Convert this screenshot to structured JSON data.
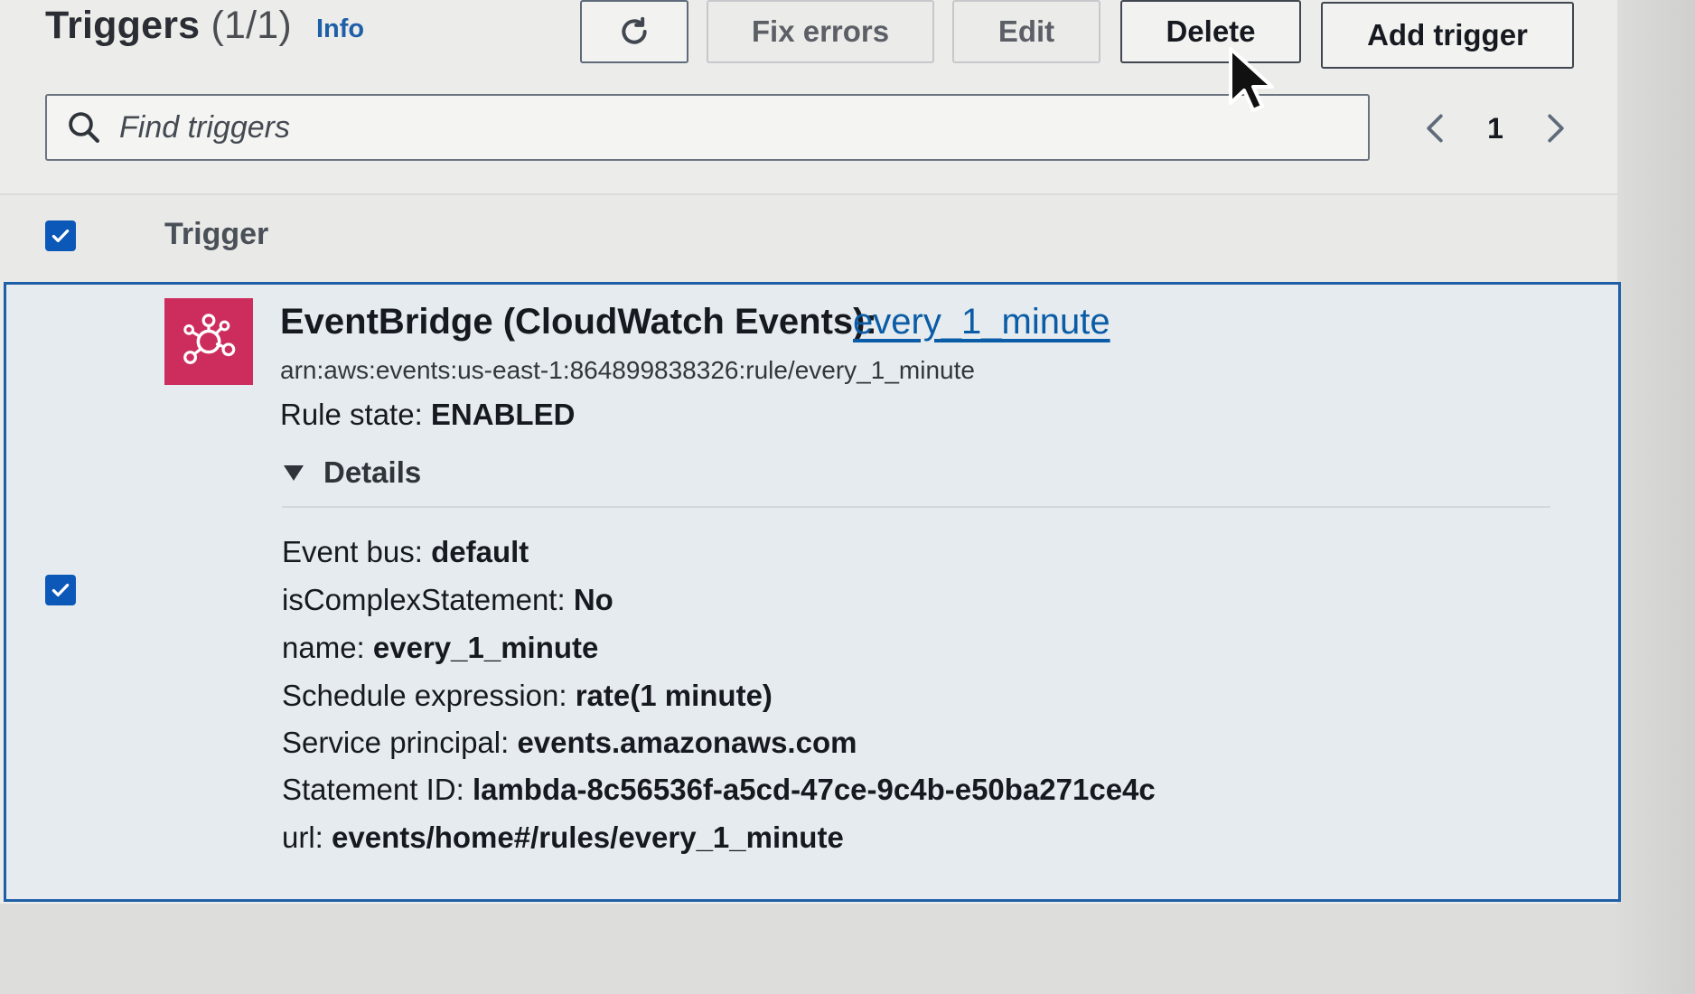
{
  "header": {
    "title": "Triggers",
    "count": "(1/1)",
    "info_label": "Info"
  },
  "toolbar": {
    "refresh_icon": "refresh-icon",
    "fix_errors_label": "Fix errors",
    "edit_label": "Edit",
    "delete_label": "Delete",
    "add_trigger_label": "Add trigger"
  },
  "search": {
    "placeholder": "Find triggers",
    "value": "",
    "icon": "search-icon"
  },
  "pagination": {
    "current_page": "1",
    "prev_icon": "chevron-left-icon",
    "next_icon": "chevron-right-icon"
  },
  "table": {
    "column_header": "Trigger",
    "all_selected": true
  },
  "trigger": {
    "selected": true,
    "icon": "eventbridge-icon",
    "icon_color": "#cd2d5c",
    "service": "EventBridge (CloudWatch Events):",
    "rule_name": "every_1_minute",
    "arn": "arn:aws:events:us-east-1:864899838326:rule/every_1_minute",
    "rule_state_label": "Rule state:",
    "rule_state_value": "ENABLED",
    "details_label": "Details",
    "details_expanded": true,
    "details": [
      {
        "key": "Event bus:",
        "value": "default"
      },
      {
        "key": "isComplexStatement:",
        "value": "No"
      },
      {
        "key": "name:",
        "value": "every_1_minute"
      },
      {
        "key": "Schedule expression:",
        "value": "rate(1 minute)"
      },
      {
        "key": "Service principal:",
        "value": "events.amazonaws.com"
      },
      {
        "key": "Statement ID:",
        "value": "lambda-8c56536f-a5cd-47ce-9c4b-e50ba271ce4c"
      },
      {
        "key": "url:",
        "value": "events/home#/rules/every_1_minute"
      }
    ]
  },
  "colors": {
    "accent_blue": "#0b58b8",
    "link_blue": "#0a5ca6",
    "selected_border": "#1f5fa8",
    "selected_bg": "#e5ebee"
  }
}
